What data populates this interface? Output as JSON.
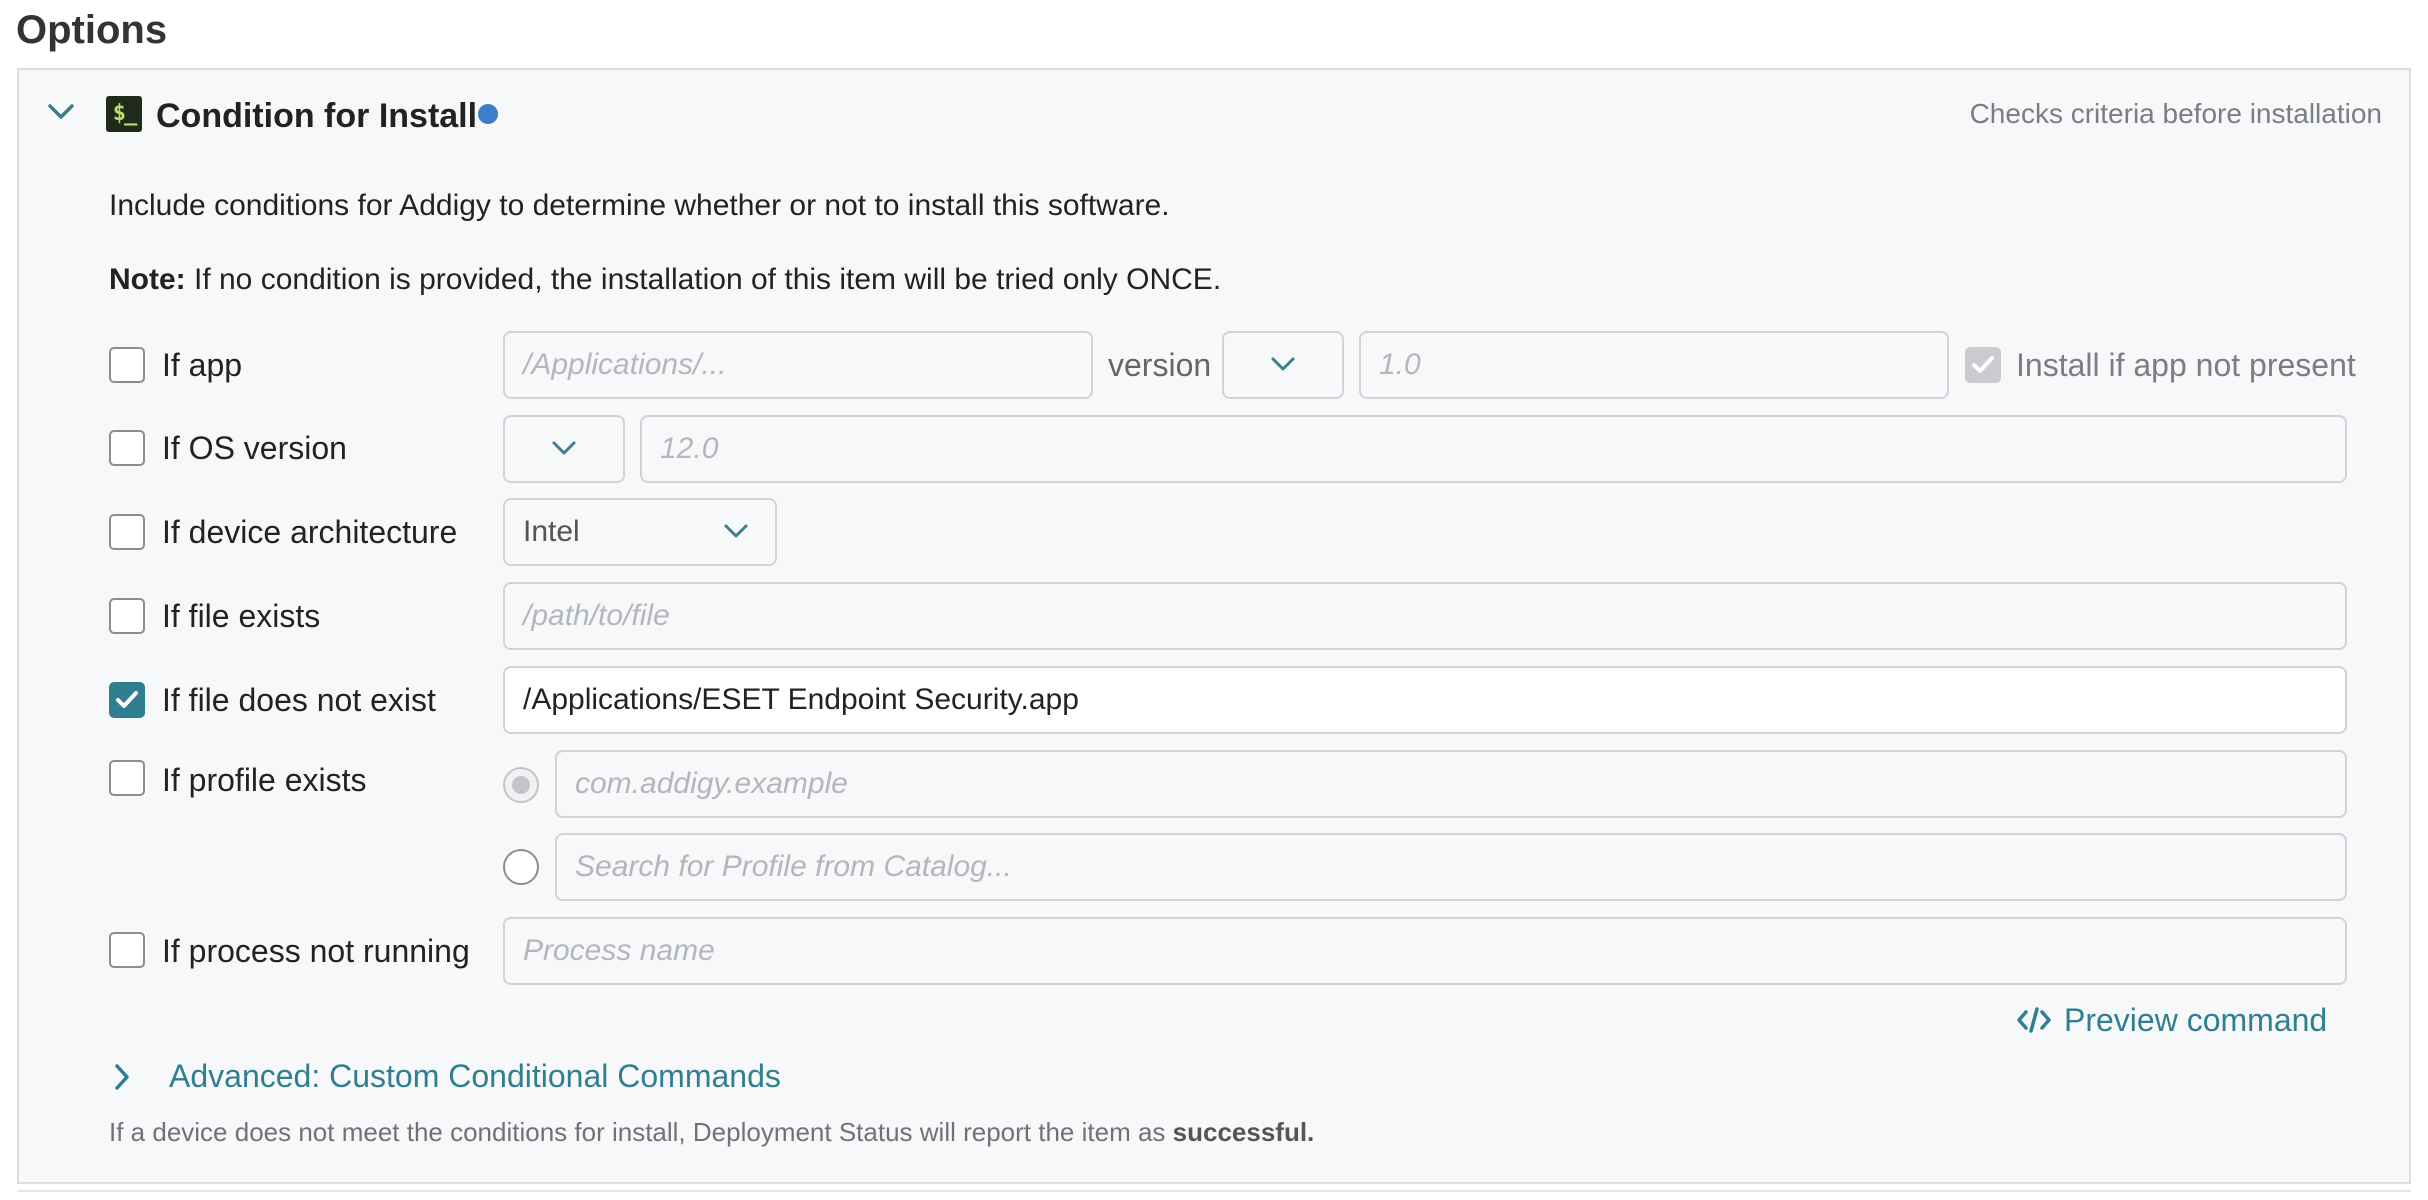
{
  "page": {
    "title": "Options"
  },
  "section": {
    "title": "Condition for Install",
    "description": "Checks criteria before installation",
    "intro": "Include conditions for Addigy to determine whether or not to install this software.",
    "note_label": "Note:",
    "note_text": " If no condition is provided, the installation of this item will be tried only ONCE."
  },
  "conditions": {
    "if_app": {
      "label": "If app",
      "checked": false,
      "path_placeholder": "/Applications/...",
      "version_label": "version",
      "version_placeholder": "1.0",
      "install_if_missing_label": "Install if app not present",
      "install_if_missing_checked": true
    },
    "if_os_version": {
      "label": "If OS version",
      "checked": false,
      "placeholder": "12.0"
    },
    "if_device_architecture": {
      "label": "If device architecture",
      "checked": false,
      "selected": "Intel"
    },
    "if_file_exists": {
      "label": "If file exists",
      "checked": false,
      "placeholder": "/path/to/file"
    },
    "if_file_not_exist": {
      "label": "If file does not exist",
      "checked": true,
      "value": "/Applications/ESET Endpoint Security.app"
    },
    "if_profile_exists": {
      "label": "If profile exists",
      "checked": false,
      "identifier_placeholder": "com.addigy.example",
      "catalog_placeholder": "Search for Profile from Catalog..."
    },
    "if_process_not_running": {
      "label": "If process not running",
      "checked": false,
      "placeholder": "Process name"
    }
  },
  "actions": {
    "preview_icon": "code-icon",
    "preview_label": "Preview command",
    "advanced_label": "Advanced: Custom Conditional Commands"
  },
  "footer": {
    "text": "If a device does not meet the conditions for install, Deployment Status will report the item as ",
    "emphasis": "successful."
  },
  "colors": {
    "accent": "#2f7f91",
    "status_dot": "#3d7dca"
  }
}
